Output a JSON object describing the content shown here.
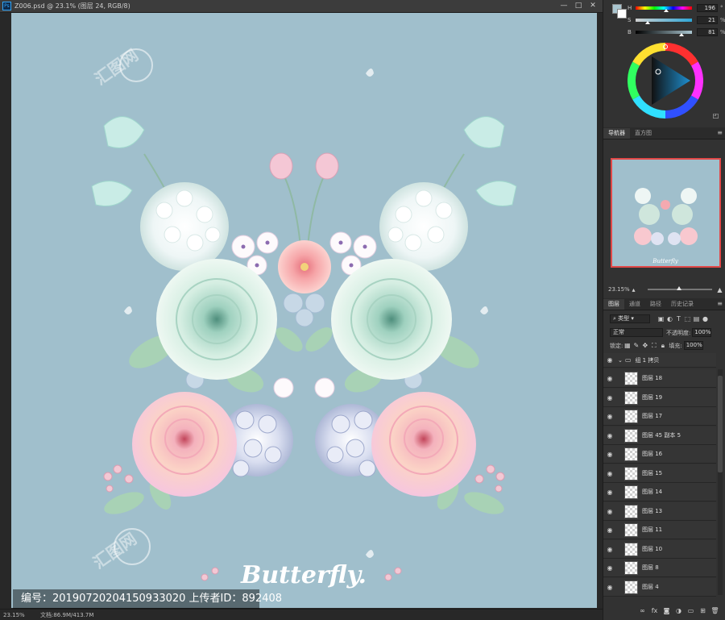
{
  "document": {
    "title": "Z006.psd @ 23.1% (图层 24, RGB/8)",
    "window_controls": [
      "—",
      "□",
      "✕"
    ],
    "canvas_color": "#a0bfcc",
    "canvas_text": "Butterfly.",
    "watermark_text": "编号：20190720204150933020 上传者ID：892408",
    "status_zoom": "23.15%",
    "status_doc_size": "文档:86.9M/413.7M"
  },
  "color_panel": {
    "foreground_color": "#aac6d0",
    "background_color": "#ffffff",
    "sliders": [
      {
        "label": "H",
        "value": "196",
        "unit": "°",
        "position": 0.54
      },
      {
        "label": "S",
        "value": "21",
        "unit": "%",
        "position": 0.21
      },
      {
        "label": "B",
        "value": "81",
        "unit": "%",
        "position": 0.81
      }
    ]
  },
  "navigator": {
    "tabs": [
      "导航器",
      "直方图"
    ],
    "zoom": "23.15%",
    "thumb_text": "Butterfly"
  },
  "layers": {
    "tabs": [
      "图层",
      "通道",
      "路径",
      "历史记录"
    ],
    "filter_kind": "类型",
    "blend_mode": "正常",
    "opacity_label": "不透明度:",
    "opacity_value": "100%",
    "lock_label": "锁定:",
    "fill_label": "填充:",
    "fill_value": "100%",
    "group_name": "组 1 拷贝",
    "items": [
      "图层 18",
      "图层 19",
      "图层 17",
      "图层 45 副本 5",
      "图层 16",
      "图层 15",
      "图层 14",
      "图层 13",
      "图层 11",
      "图层 10",
      "图层 8",
      "图层 4"
    ]
  }
}
